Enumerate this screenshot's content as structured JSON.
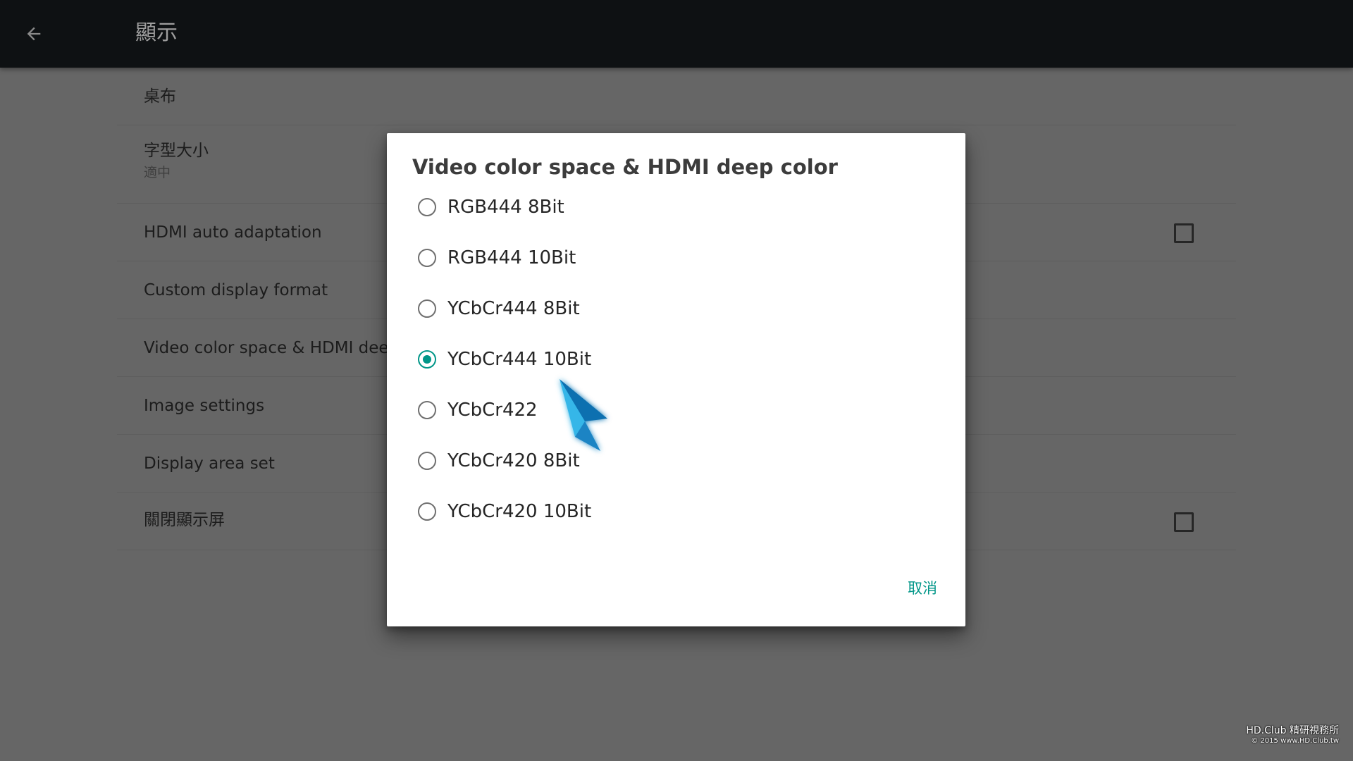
{
  "appbar": {
    "title": "顯示",
    "back_icon": "arrow-left-icon"
  },
  "settings": {
    "items": [
      {
        "title": "桌布",
        "subtitle": ""
      },
      {
        "title": "字型大小",
        "subtitle": "適中"
      },
      {
        "title": "HDMI auto adaptation",
        "checkbox": false
      },
      {
        "title": "Custom display format"
      },
      {
        "title": "Video color space & HDMI deep"
      },
      {
        "title": "Image settings"
      },
      {
        "title": "Display area set"
      },
      {
        "title": "關閉顯示屏",
        "checkbox": false
      }
    ]
  },
  "dialog": {
    "title": "Video color space & HDMI deep color",
    "options": [
      {
        "label": "RGB444 8Bit",
        "selected": false
      },
      {
        "label": "RGB444 10Bit",
        "selected": false
      },
      {
        "label": "YCbCr444 8Bit",
        "selected": false
      },
      {
        "label": "YCbCr444 10Bit",
        "selected": true
      },
      {
        "label": "YCbCr422",
        "selected": false
      },
      {
        "label": "YCbCr420 8Bit",
        "selected": false
      },
      {
        "label": "YCbCr420 10Bit",
        "selected": false
      }
    ],
    "cancel_label": "取消"
  },
  "watermark": {
    "line1": "HD.Club 精研視務所",
    "line2": "© 2015  www.HD.Club.tw"
  },
  "colors": {
    "accent": "#009688",
    "appbar_bg": "#0e1113",
    "dim_bg": "#666666",
    "pointer": "#1e9bd6"
  }
}
